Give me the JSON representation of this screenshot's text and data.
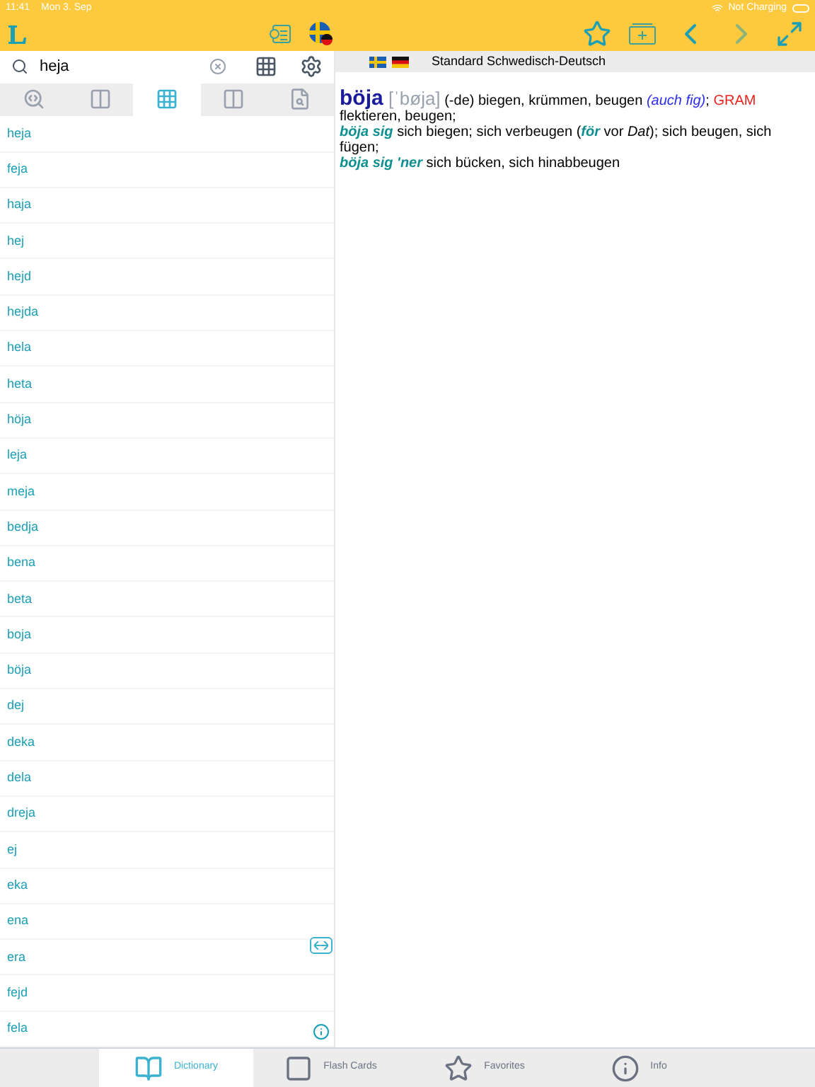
{
  "status_bar": {
    "time": "11:41",
    "date": "Mon 3. Sep",
    "battery": "Not Charging"
  },
  "search": {
    "value": "heja"
  },
  "mode_tabs": [
    {
      "kind": "search",
      "selected": false
    },
    {
      "kind": "quiz",
      "selected": false
    },
    {
      "kind": "grid",
      "selected": true
    },
    {
      "kind": "compare",
      "selected": false
    },
    {
      "kind": "fulltext",
      "selected": false
    }
  ],
  "words": [
    {
      "text": "heja"
    },
    {
      "text": "feja"
    },
    {
      "text": "haja"
    },
    {
      "text": "hej"
    },
    {
      "text": "hejd"
    },
    {
      "text": "hejda"
    },
    {
      "text": "hela"
    },
    {
      "text": "heta"
    },
    {
      "text": "höja"
    },
    {
      "text": "leja"
    },
    {
      "text": "meja"
    },
    {
      "text": "bedja"
    },
    {
      "text": "bena"
    },
    {
      "text": "beta"
    },
    {
      "text": "boja"
    },
    {
      "text": "böja"
    },
    {
      "text": "dej"
    },
    {
      "text": "deka"
    },
    {
      "text": "dela"
    },
    {
      "text": "dreja"
    },
    {
      "text": "ej"
    },
    {
      "text": "eka"
    },
    {
      "text": "ena"
    },
    {
      "text": "era"
    },
    {
      "text": "fejd"
    },
    {
      "text": "fela"
    }
  ],
  "dictionary_title": "Standard Schwedisch-Deutsch",
  "entry_lines": [
    [
      {
        "kind": "headword",
        "text": "böja"
      },
      {
        "kind": "pron",
        "text": " [ˈbøja]"
      },
      {
        "kind": "plain",
        "text": " (-de) biegen, krümmen, beugen "
      },
      {
        "kind": "note",
        "text": "(auch fig)"
      },
      {
        "kind": "plain",
        "text": "; "
      },
      {
        "kind": "gram",
        "text": "GRAM"
      },
      {
        "kind": "plain",
        "text": " flektieren, beugen;"
      }
    ],
    [
      {
        "kind": "phrase",
        "text": "böja sig"
      },
      {
        "kind": "plain",
        "text": " sich biegen; sich verbeugen ("
      },
      {
        "kind": "phrase",
        "text": "för"
      },
      {
        "kind": "plain",
        "text": " vor "
      },
      {
        "kind": "italic",
        "text": "Dat"
      },
      {
        "kind": "plain",
        "text": "); sich beugen, sich fügen;"
      }
    ],
    [
      {
        "kind": "phrase",
        "text": "böja sig 'ner"
      },
      {
        "kind": "plain",
        "text": " sich bücken, sich hinabbeugen"
      }
    ]
  ],
  "bottom_tabs": [
    {
      "kind": "dictionary",
      "label": "Dictionary",
      "selected": true
    },
    {
      "kind": "cards",
      "label": "Flash Cards",
      "selected": false
    },
    {
      "kind": "star",
      "label": "Favorites",
      "selected": false
    },
    {
      "kind": "info",
      "label": "Info",
      "selected": false
    }
  ]
}
